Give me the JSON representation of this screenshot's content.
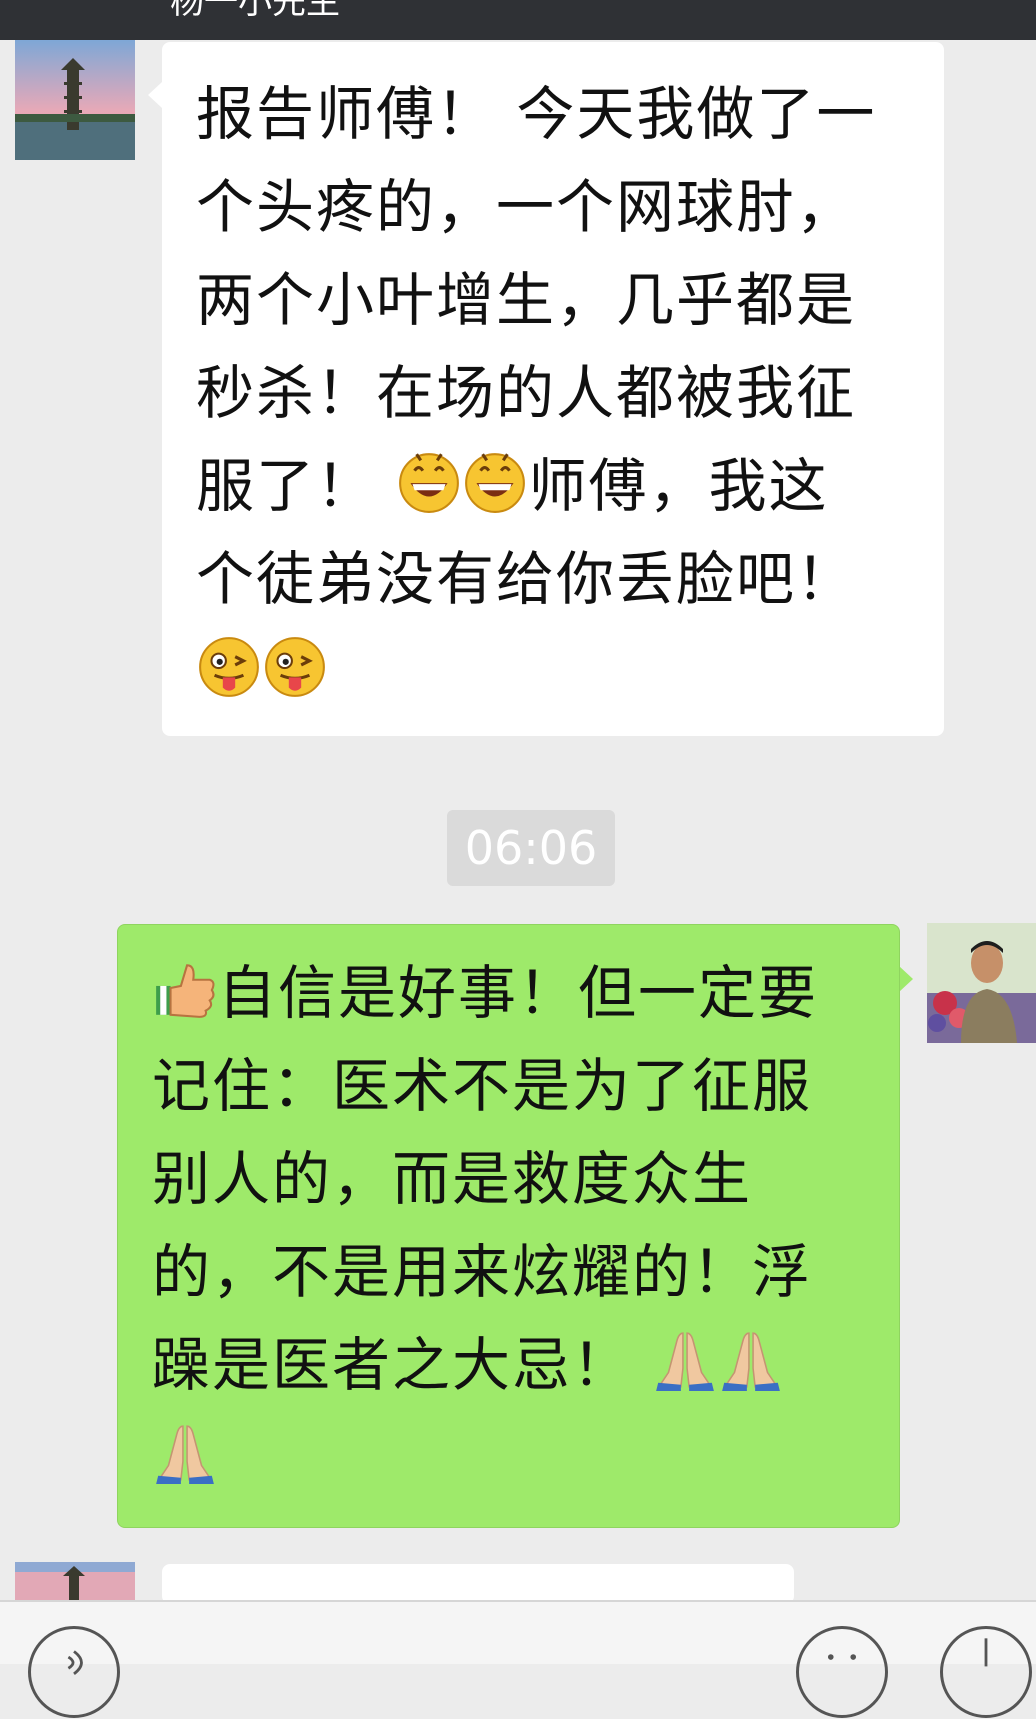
{
  "header": {
    "title": "杨一小先生"
  },
  "messages": [
    {
      "side": "left",
      "lines": [
        [
          {
            "t": "text",
            "v": "报告师傅！ 今天我做了一"
          }
        ],
        [
          {
            "t": "text",
            "v": "个头疼的，一个网球肘，"
          }
        ],
        [
          {
            "t": "text",
            "v": "两个小叶增生，几乎都是"
          }
        ],
        [
          {
            "t": "text",
            "v": "秒杀！在场的人都被我征"
          }
        ],
        [
          {
            "t": "text",
            "v": "服了！ "
          },
          {
            "t": "emoji",
            "v": "grin-icon"
          },
          {
            "t": "emoji",
            "v": "grin-icon"
          },
          {
            "t": "text",
            "v": "师傅，我这"
          }
        ],
        [
          {
            "t": "text",
            "v": "个徒弟没有给你丢脸吧！"
          }
        ],
        [
          {
            "t": "emoji",
            "v": "wink-tongue-icon"
          },
          {
            "t": "emoji",
            "v": "wink-tongue-icon"
          }
        ]
      ]
    },
    {
      "side": "right",
      "lines": [
        [
          {
            "t": "emoji",
            "v": "thumbs-up-icon"
          },
          {
            "t": "text",
            "v": "自信是好事！但一定要"
          }
        ],
        [
          {
            "t": "text",
            "v": "记住：医术不是为了征服"
          }
        ],
        [
          {
            "t": "text",
            "v": "别人的，而是救度众生"
          }
        ],
        [
          {
            "t": "text",
            "v": "的，不是用来炫耀的！浮"
          }
        ],
        [
          {
            "t": "text",
            "v": "躁是医者之大忌！ "
          },
          {
            "t": "emoji",
            "v": "pray-icon"
          },
          {
            "t": "emoji",
            "v": "pray-icon"
          }
        ],
        [
          {
            "t": "emoji",
            "v": "pray-icon"
          }
        ]
      ]
    }
  ],
  "timestamp": "06:06",
  "colors": {
    "chat_bg": "#ececec",
    "sent_bubble": "#9eea6a",
    "received_bubble": "#ffffff",
    "topbar": "#2f3135"
  }
}
